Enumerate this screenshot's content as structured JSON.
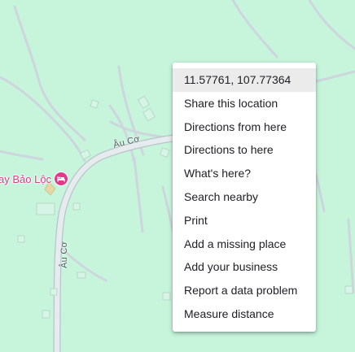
{
  "map": {
    "background_color": "#c7f5dc",
    "road_color": "#d9dee2",
    "roads": [
      {
        "name": "Âu Cơ"
      },
      {
        "name": "Âu Cơ"
      }
    ],
    "poi": {
      "label": "ay Bảo Lộc",
      "icon": "hotel-icon",
      "color": "#e23a8a"
    }
  },
  "context_menu": {
    "items": [
      {
        "label": "11.57761, 107.77364",
        "highlighted": true
      },
      {
        "label": "Share this location"
      },
      {
        "label": "Directions from here"
      },
      {
        "label": "Directions to here"
      },
      {
        "label": "What's here?"
      },
      {
        "label": "Search nearby"
      },
      {
        "label": "Print"
      },
      {
        "label": "Add a missing place"
      },
      {
        "label": "Add your business"
      },
      {
        "label": "Report a data problem"
      },
      {
        "label": "Measure distance"
      }
    ]
  }
}
